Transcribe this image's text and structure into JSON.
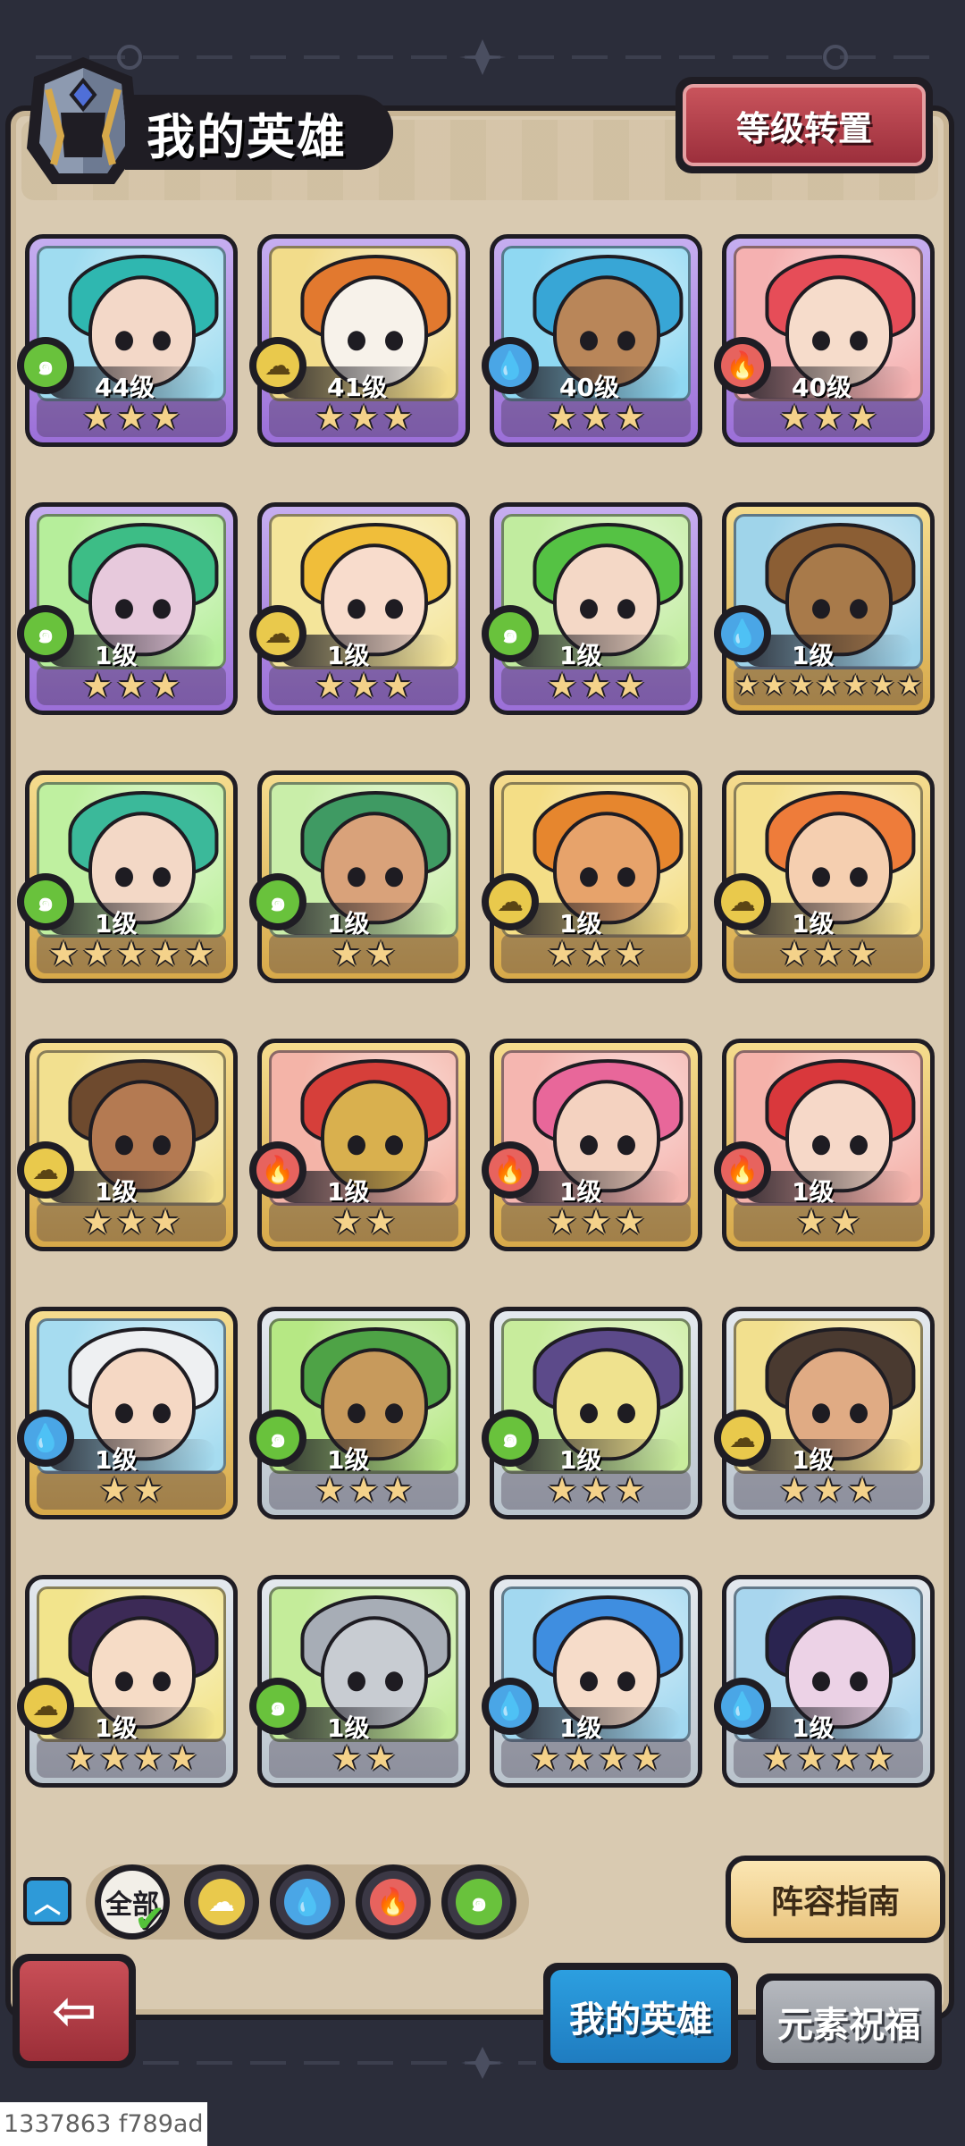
{
  "header": {
    "title": "我的英雄",
    "level_reset_label": "等级转置"
  },
  "colors": {
    "wind": "#69c23c",
    "earth": "#e9c94c",
    "water": "#4aa6e6",
    "fire": "#e7635e",
    "rarity_purple": "#9b6fd8",
    "rarity_gold": "#d7a94a",
    "rarity_silver": "#b9c3cc"
  },
  "heroes": [
    {
      "level": "44级",
      "element": "wind",
      "rarity": "purple",
      "stars": 3,
      "portrait": "teal-hair-elf",
      "skin": "#f3d8c8",
      "hair": "#2fb7b0",
      "bg": "#9fdcf0"
    },
    {
      "level": "41级",
      "element": "earth",
      "rarity": "purple",
      "stars": 3,
      "portrait": "tiger-warrior",
      "skin": "#f7f2ea",
      "hair": "#e2792f",
      "bg": "#f2dc8a"
    },
    {
      "level": "40级",
      "element": "water",
      "rarity": "purple",
      "stars": 3,
      "portrait": "blue-hair-archer",
      "skin": "#b98659",
      "hair": "#38a6d6",
      "bg": "#8fd8f2"
    },
    {
      "level": "40级",
      "element": "fire",
      "rarity": "purple",
      "stars": 3,
      "portrait": "red-hair-rose",
      "skin": "#f6dccb",
      "hair": "#e64d58",
      "bg": "#f5b1b1"
    },
    {
      "level": "1级",
      "element": "wind",
      "rarity": "purple",
      "stars": 3,
      "portrait": "green-hair-mage",
      "skin": "#e7c9dc",
      "hair": "#3dbd86",
      "bg": "#b6ee9b"
    },
    {
      "level": "1级",
      "element": "earth",
      "rarity": "purple",
      "stars": 3,
      "portrait": "blonde-girl",
      "skin": "#f8dccc",
      "hair": "#f0be3a",
      "bg": "#f4e59a"
    },
    {
      "level": "1级",
      "element": "wind",
      "rarity": "purple",
      "stars": 3,
      "portrait": "green-mohawk",
      "skin": "#f4d8c6",
      "hair": "#55c244",
      "bg": "#c1ec9f"
    },
    {
      "level": "1级",
      "element": "water",
      "rarity": "gold",
      "stars": 7,
      "portrait": "wooden-golem",
      "skin": "#a87a4a",
      "hair": "#8b5e34",
      "bg": "#9fd4ea"
    },
    {
      "level": "1级",
      "element": "wind",
      "rarity": "gold",
      "stars": 5,
      "portrait": "jade-crown-elf",
      "skin": "#f3d8c6",
      "hair": "#3bb99a",
      "bg": "#bff0a0"
    },
    {
      "level": "1级",
      "element": "wind",
      "rarity": "gold",
      "stars": 2,
      "portrait": "green-hair-tribal",
      "skin": "#d9a27a",
      "hair": "#3f9a63",
      "bg": "#c9eea9"
    },
    {
      "level": "1级",
      "element": "earth",
      "rarity": "gold",
      "stars": 3,
      "portrait": "orange-beard-dwarf",
      "skin": "#e7a36b",
      "hair": "#e6862e",
      "bg": "#f4de86"
    },
    {
      "level": "1级",
      "element": "earth",
      "rarity": "gold",
      "stars": 3,
      "portrait": "orange-hair-bandana",
      "skin": "#f5cfb0",
      "hair": "#ee7c3a",
      "bg": "#f4e08e"
    },
    {
      "level": "1级",
      "element": "earth",
      "rarity": "gold",
      "stars": 3,
      "portrait": "dreadlock-warrior",
      "skin": "#b47a52",
      "hair": "#6e4a2e",
      "bg": "#f2e08f"
    },
    {
      "level": "1级",
      "element": "fire",
      "rarity": "gold",
      "stars": 2,
      "portrait": "golden-helm-knight",
      "skin": "#d9b04e",
      "hair": "#d63f3a",
      "bg": "#f4b4a8"
    },
    {
      "level": "1级",
      "element": "fire",
      "rarity": "gold",
      "stars": 3,
      "portrait": "pink-hair-pirate",
      "skin": "#f4d2c0",
      "hair": "#e8679a",
      "bg": "#f5b6b0"
    },
    {
      "level": "1级",
      "element": "fire",
      "rarity": "gold",
      "stars": 2,
      "portrait": "red-braid-monocle",
      "skin": "#f6d8c8",
      "hair": "#d9383c",
      "bg": "#f5b2aa"
    },
    {
      "level": "1级",
      "element": "water",
      "rarity": "gold",
      "stars": 2,
      "portrait": "white-hair-goggles",
      "skin": "#f5d8c4",
      "hair": "#eef0f2",
      "bg": "#a6dcf0"
    },
    {
      "level": "1级",
      "element": "wind",
      "rarity": "silver",
      "stars": 3,
      "portrait": "wooden-mask-sprout",
      "skin": "#c79a5c",
      "hair": "#4ea346",
      "bg": "#b6e884"
    },
    {
      "level": "1级",
      "element": "wind",
      "rarity": "silver",
      "stars": 3,
      "portrait": "horned-shaman",
      "skin": "#efe28e",
      "hair": "#5c4a8a",
      "bg": "#c8ec9c"
    },
    {
      "level": "1级",
      "element": "earth",
      "rarity": "silver",
      "stars": 3,
      "portrait": "bearded-man",
      "skin": "#e0ab84",
      "hair": "#4a3a30",
      "bg": "#f2e08e"
    },
    {
      "level": "1级",
      "element": "earth",
      "rarity": "silver",
      "stars": 4,
      "portrait": "dark-hair-ninja",
      "skin": "#f6dcc6",
      "hair": "#3c2a56",
      "bg": "#f2e48c"
    },
    {
      "level": "1级",
      "element": "wind",
      "rarity": "silver",
      "stars": 2,
      "portrait": "steel-helm-knight",
      "skin": "#c8ccd2",
      "hair": "#a7adb6",
      "bg": "#c4ec9a"
    },
    {
      "level": "1级",
      "element": "water",
      "rarity": "silver",
      "stars": 4,
      "portrait": "blue-hair-girl",
      "skin": "#f6dcc9",
      "hair": "#3f8ee0",
      "bg": "#a2d8f0"
    },
    {
      "level": "1级",
      "element": "water",
      "rarity": "silver",
      "stars": 4,
      "portrait": "dark-hair-sorceress",
      "skin": "#ecd2e6",
      "hair": "#2a2450",
      "bg": "#a8d6ee"
    }
  ],
  "filters": {
    "all_label": "全部",
    "items": [
      {
        "element": "earth",
        "icon": "earth-element-icon"
      },
      {
        "element": "water",
        "icon": "water-element-icon"
      },
      {
        "element": "fire",
        "icon": "fire-element-icon"
      },
      {
        "element": "wind",
        "icon": "wind-element-icon"
      }
    ]
  },
  "guide_label": "阵容指南",
  "tabs": {
    "my_heroes": "我的英雄",
    "element_blessing": "元素祝福"
  },
  "watermark": "1337863 f789ad"
}
